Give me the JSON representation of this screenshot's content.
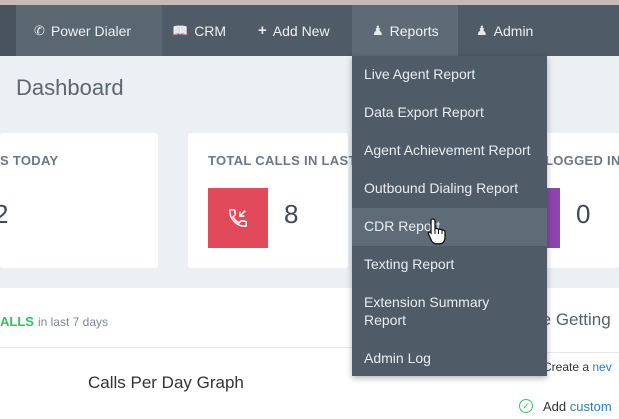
{
  "nav": {
    "items": [
      {
        "label": "Power Dialer",
        "icon": "phone-icon"
      },
      {
        "label": "CRM",
        "icon": "book-icon"
      },
      {
        "label": "Add New",
        "icon": "plus-icon"
      },
      {
        "label": "Reports",
        "icon": "user-icon"
      },
      {
        "label": "Admin",
        "icon": "user-icon"
      }
    ]
  },
  "page": {
    "title": "Dashboard"
  },
  "cards": [
    {
      "label": "S TODAY",
      "value": "2"
    },
    {
      "label": "TOTAL CALLS IN LAST",
      "value": "8",
      "icon_color": "#e04a5a"
    },
    {
      "label": "LOGGED IN",
      "value": "0",
      "icon_color": "#8e44ad"
    }
  ],
  "calls_panel": {
    "title": "ALLS",
    "subtitle": "in last 7 days",
    "graph_title": "Calls Per Day Graph"
  },
  "getting_started": {
    "title": "re Getting",
    "items": [
      {
        "prefix": "Create a",
        "link": "nev"
      },
      {
        "prefix": "Add",
        "link": "custom"
      }
    ]
  },
  "reports_menu": {
    "items": [
      "Live Agent Report",
      "Data Export Report",
      "Agent Achievement Report",
      "Outbound Dialing Report",
      "CDR Report",
      "Texting Report",
      "Extension Summary Report",
      "Admin Log"
    ],
    "hovered": "CDR Report"
  }
}
